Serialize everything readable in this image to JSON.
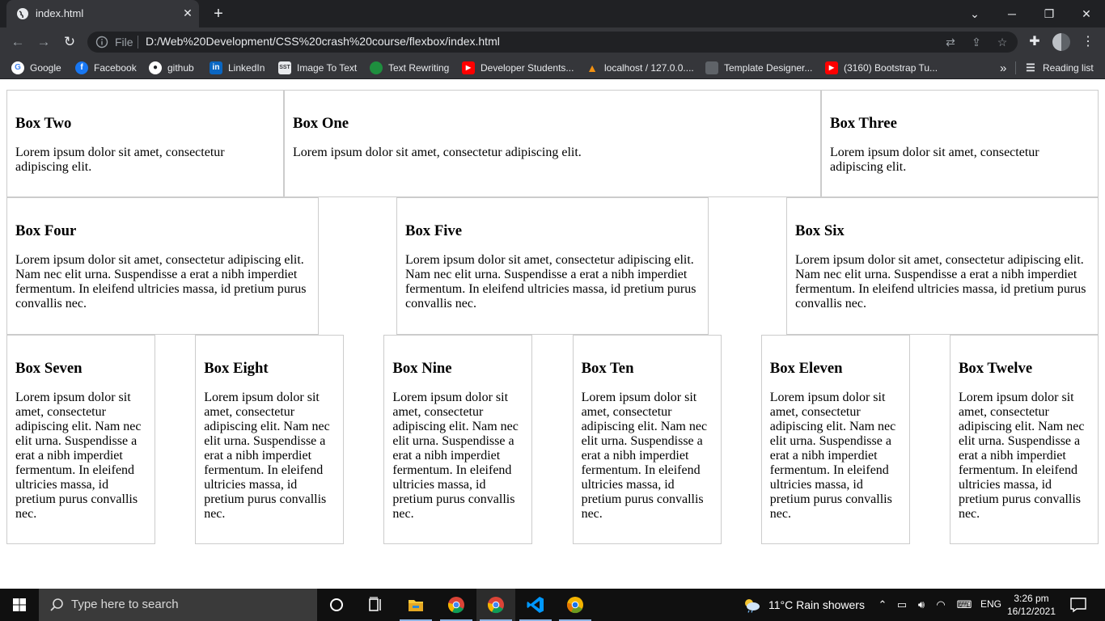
{
  "browser": {
    "tab_title": "index.html",
    "new_tab": "+",
    "address": {
      "scheme_label": "File",
      "url": "D:/Web%20Development/CSS%20crash%20course/flexbox/index.html"
    },
    "bookmarks": [
      {
        "label": "Google",
        "icon": "google-icon",
        "color": "#4285f4"
      },
      {
        "label": "Facebook",
        "icon": "facebook-icon",
        "color": "#1877f2"
      },
      {
        "label": "github",
        "icon": "github-icon",
        "color": "#ffffff"
      },
      {
        "label": "LinkedIn",
        "icon": "linkedin-icon",
        "color": "#0a66c2"
      },
      {
        "label": "Image To Text",
        "icon": "image-to-text-icon",
        "color": "#e8eaed"
      },
      {
        "label": "Text Rewriting",
        "icon": "text-rewriting-icon",
        "color": "#1e8e3e"
      },
      {
        "label": "Developer Students...",
        "icon": "youtube-icon",
        "color": "#ff0000"
      },
      {
        "label": "localhost / 127.0.0....",
        "icon": "phpmyadmin-icon",
        "color": "#f29111"
      },
      {
        "label": "Template Designer...",
        "icon": "template-designer-icon",
        "color": "#5f6368"
      },
      {
        "label": "(3160) Bootstrap Tu...",
        "icon": "youtube-icon",
        "color": "#ff0000"
      }
    ],
    "overflow_label": "»",
    "reading_list": "Reading list"
  },
  "page": {
    "row1": [
      {
        "title": "Box Two",
        "text": "Lorem ipsum dolor sit amet, consectetur adipiscing elit."
      },
      {
        "title": "Box One",
        "text": "Lorem ipsum dolor sit amet, consectetur adipiscing elit."
      },
      {
        "title": "Box Three",
        "text": "Lorem ipsum dolor sit amet, consectetur adipiscing elit."
      }
    ],
    "row2": [
      {
        "title": "Box Four",
        "text": "Lorem ipsum dolor sit amet, consectetur adipiscing elit. Nam nec elit urna. Suspendisse a erat a nibh imperdiet fermentum. In eleifend ultricies massa, id pretium purus convallis nec."
      },
      {
        "title": "Box Five",
        "text": "Lorem ipsum dolor sit amet, consectetur adipiscing elit. Nam nec elit urna. Suspendisse a erat a nibh imperdiet fermentum. In eleifend ultricies massa, id pretium purus convallis nec."
      },
      {
        "title": "Box Six",
        "text": "Lorem ipsum dolor sit amet, consectetur adipiscing elit. Nam nec elit urna. Suspendisse a erat a nibh imperdiet fermentum. In eleifend ultricies massa, id pretium purus convallis nec."
      }
    ],
    "row3": [
      {
        "title": "Box Seven",
        "text": "Lorem ipsum dolor sit amet, consectetur adipiscing elit. Nam nec elit urna. Suspendisse a erat a nibh imperdiet fermentum. In eleifend ultricies massa, id pretium purus convallis nec."
      },
      {
        "title": "Box Eight",
        "text": "Lorem ipsum dolor sit amet, consectetur adipiscing elit. Nam nec elit urna. Suspendisse a erat a nibh imperdiet fermentum. In eleifend ultricies massa, id pretium purus convallis nec."
      },
      {
        "title": "Box Nine",
        "text": "Lorem ipsum dolor sit amet, consectetur adipiscing elit. Nam nec elit urna. Suspendisse a erat a nibh imperdiet fermentum. In eleifend ultricies massa, id pretium purus convallis nec."
      },
      {
        "title": "Box Ten",
        "text": "Lorem ipsum dolor sit amet, consectetur adipiscing elit. Nam nec elit urna. Suspendisse a erat a nibh imperdiet fermentum. In eleifend ultricies massa, id pretium purus convallis nec."
      },
      {
        "title": "Box Eleven",
        "text": "Lorem ipsum dolor sit amet, consectetur adipiscing elit. Nam nec elit urna. Suspendisse a erat a nibh imperdiet fermentum. In eleifend ultricies massa, id pretium purus convallis nec."
      },
      {
        "title": "Box Twelve",
        "text": "Lorem ipsum dolor sit amet, consectetur adipiscing elit. Nam nec elit urna. Suspendisse a erat a nibh imperdiet fermentum. In eleifend ultricies massa, id pretium purus convallis nec."
      }
    ]
  },
  "taskbar": {
    "search_placeholder": "Type here to search",
    "weather": "11°C  Rain showers",
    "language": "ENG",
    "time": "3:26 pm",
    "date": "16/12/2021",
    "apps": [
      "cortana-icon",
      "task-view-icon",
      "file-explorer-icon",
      "chrome-icon",
      "chrome-icon",
      "vscode-icon",
      "chrome-canary-icon"
    ]
  },
  "colors": {
    "chrome_dark": "#202124",
    "chrome_toolbar": "#35363a",
    "box_border": "#cccccc",
    "taskbar": "#101010"
  }
}
